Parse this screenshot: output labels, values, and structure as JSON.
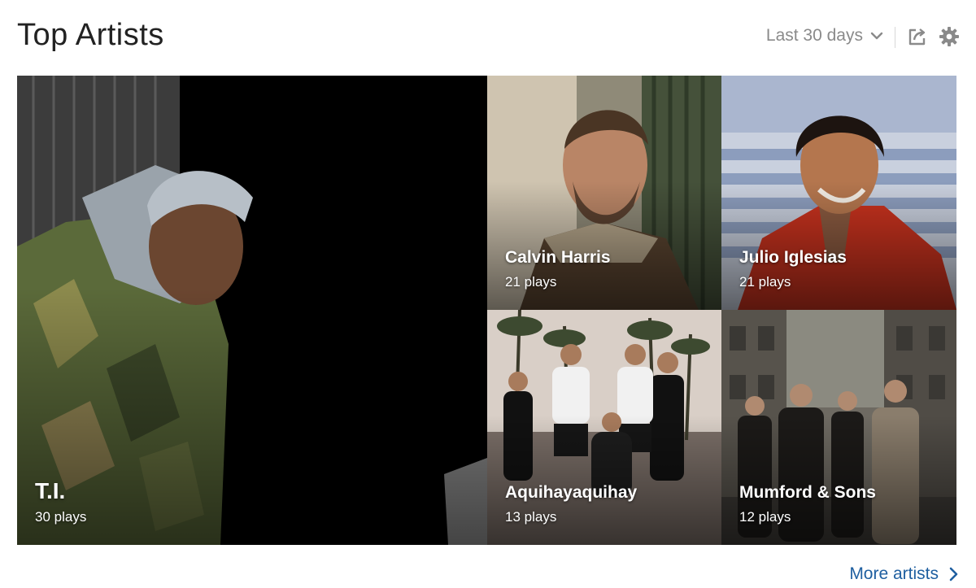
{
  "header": {
    "title": "Top Artists",
    "range_label": "Last 30 days",
    "icons": {
      "dropdown": "chevron-down-icon",
      "share": "share-icon",
      "settings": "gear-icon"
    }
  },
  "artists": [
    {
      "name": "T.I.",
      "plays": "30 plays",
      "image": "artist-photo"
    },
    {
      "name": "Calvin Harris",
      "plays": "21 plays",
      "image": "artist-photo"
    },
    {
      "name": "Julio Iglesias",
      "plays": "21 plays",
      "image": "artist-photo"
    },
    {
      "name": "Aquihayaquihay",
      "plays": "13 plays",
      "image": "group-photo"
    },
    {
      "name": "Mumford & Sons",
      "plays": "12 plays",
      "image": "group-photo"
    }
  ],
  "footer": {
    "more_label": "More artists",
    "icon": "chevron-right-icon"
  },
  "colors": {
    "link": "#1f5fa0",
    "muted": "#8a8a8a",
    "title": "#222222"
  }
}
